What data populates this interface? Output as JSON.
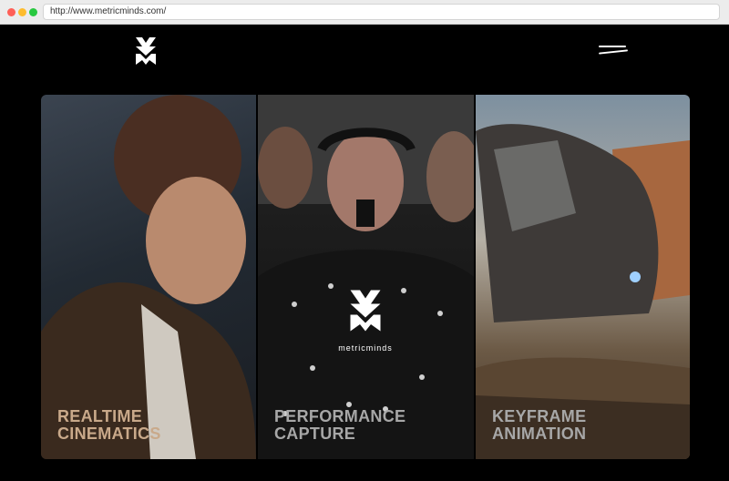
{
  "browser": {
    "url": "http://www.metricminds.com/"
  },
  "header": {
    "logo_icon": "metricminds-x-logo-icon",
    "menu_icon": "hamburger-menu-icon"
  },
  "panels": [
    {
      "title_line1": "REALTIME",
      "title_line2": "CINEMATICS"
    },
    {
      "title_line1": "PERFORMANCE",
      "title_line2": "CAPTURE",
      "brand": "metricminds"
    },
    {
      "title_line1": "KEYFRAME",
      "title_line2": "ANIMATION"
    }
  ]
}
